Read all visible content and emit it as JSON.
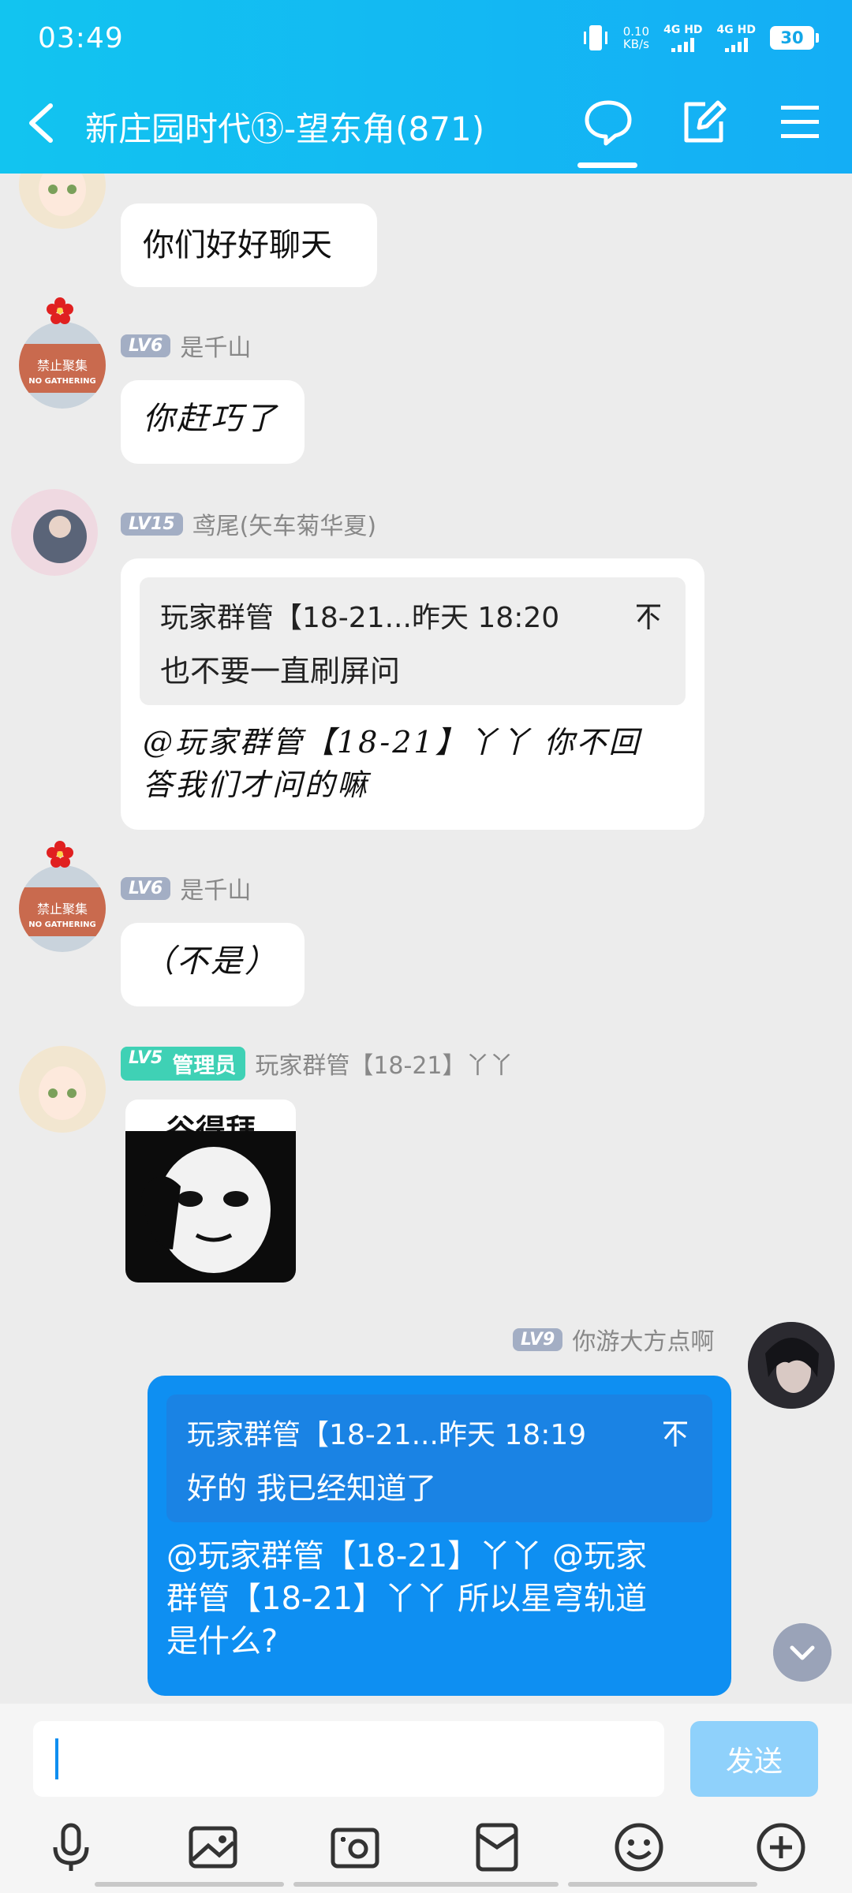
{
  "status": {
    "time": "03:49",
    "net_speed_top": "0.10",
    "net_speed_unit": "KB/s",
    "sim1": "4G HD",
    "sim2": "4G HD",
    "battery": "30"
  },
  "header": {
    "title": "新庄园时代⑬-望东角(871)"
  },
  "messages": {
    "m1": {
      "text": "你们好好聊天"
    },
    "m2": {
      "level": "LV6",
      "name": "是千山",
      "text": "你赶巧了"
    },
    "m3": {
      "level": "LV15",
      "name": "鸢尾(矢车菊华夏)",
      "quote_head": "玩家群管【18-21...昨天 18:20",
      "quote_body": "也不要一直刷屏问",
      "text_line1": "@玩家群管【18-21】丫丫 你不回",
      "text_line2": "答我们才问的嘛"
    },
    "m4": {
      "level": "LV6",
      "name": "是千山",
      "text": "（不是）"
    },
    "m5": {
      "level": "LV5",
      "role": "管理员",
      "name": "玩家群管【18-21】丫丫",
      "sticker_text": "谷得拜"
    },
    "m6": {
      "level": "LV9",
      "name": "你游大方点啊",
      "quote_head": "玩家群管【18-21...昨天 18:19",
      "quote_body": "好的 我已经知道了",
      "text_line1": "@玩家群管【18-21】丫丫 @玩家",
      "text_line2": "群管【18-21】丫丫 所以星穹轨道",
      "text_line3": "是什么?"
    }
  },
  "avatar_badge": {
    "line1": "禁止聚集",
    "line2": "NO GATHERING"
  },
  "input": {
    "value": "",
    "send_label": "发送"
  },
  "colors": {
    "header": "#14aef5",
    "my_bubble": "#0e8ff2",
    "send": "#8fd1fb"
  }
}
